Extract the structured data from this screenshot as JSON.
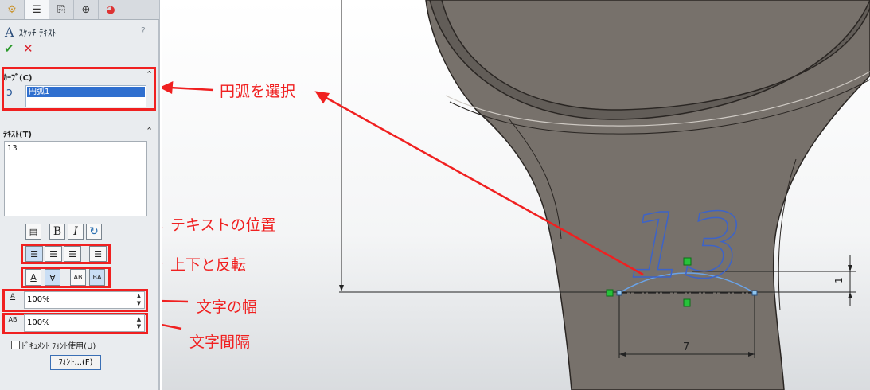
{
  "panel": {
    "title": "ｽｹｯﾁ ﾃｷｽﾄ",
    "title_icon": "A",
    "help": "?",
    "ok_glyph": "✔",
    "cancel_glyph": "✕",
    "tabs": [
      "feature-manager-icon",
      "property-manager-icon",
      "configuration-manager-icon",
      "dim-xpert-icon",
      "display-manager-icon"
    ],
    "curve_section": {
      "label": "ｶｰﾌﾞ(C)",
      "selected_item": "円弧1"
    },
    "text_section": {
      "label": "ﾃｷｽﾄ(T)",
      "value": "13"
    },
    "format_buttons": {
      "bold": "B",
      "italic": "I"
    },
    "flip_buttons": [
      "A",
      "A",
      "AB",
      "BA"
    ],
    "width_field": {
      "value": "100%",
      "icon_text": "A"
    },
    "spacing_field": {
      "value": "100%",
      "icon_text": "AB"
    },
    "checkbox_label": "ﾄﾞｷｭﾒﾝﾄ ﾌｫﾝﾄ使用(U)",
    "font_button": "ﾌｫﾝﾄ...(F)"
  },
  "annotations": {
    "select_arc": "円弧を選択",
    "text_position": "テキストの位置",
    "flip": "上下と反転",
    "char_width": "文字の幅",
    "char_spacing": "文字間隔"
  },
  "sketch": {
    "sketch_text": "13",
    "dimension_horizontal": "7",
    "dimension_vertical": "1"
  },
  "colors": {
    "annotation_red": "#f02020",
    "model_gray": "#77716b",
    "sketch_blue": "#3d63c7",
    "selected_blue": "#2f6fcf"
  }
}
